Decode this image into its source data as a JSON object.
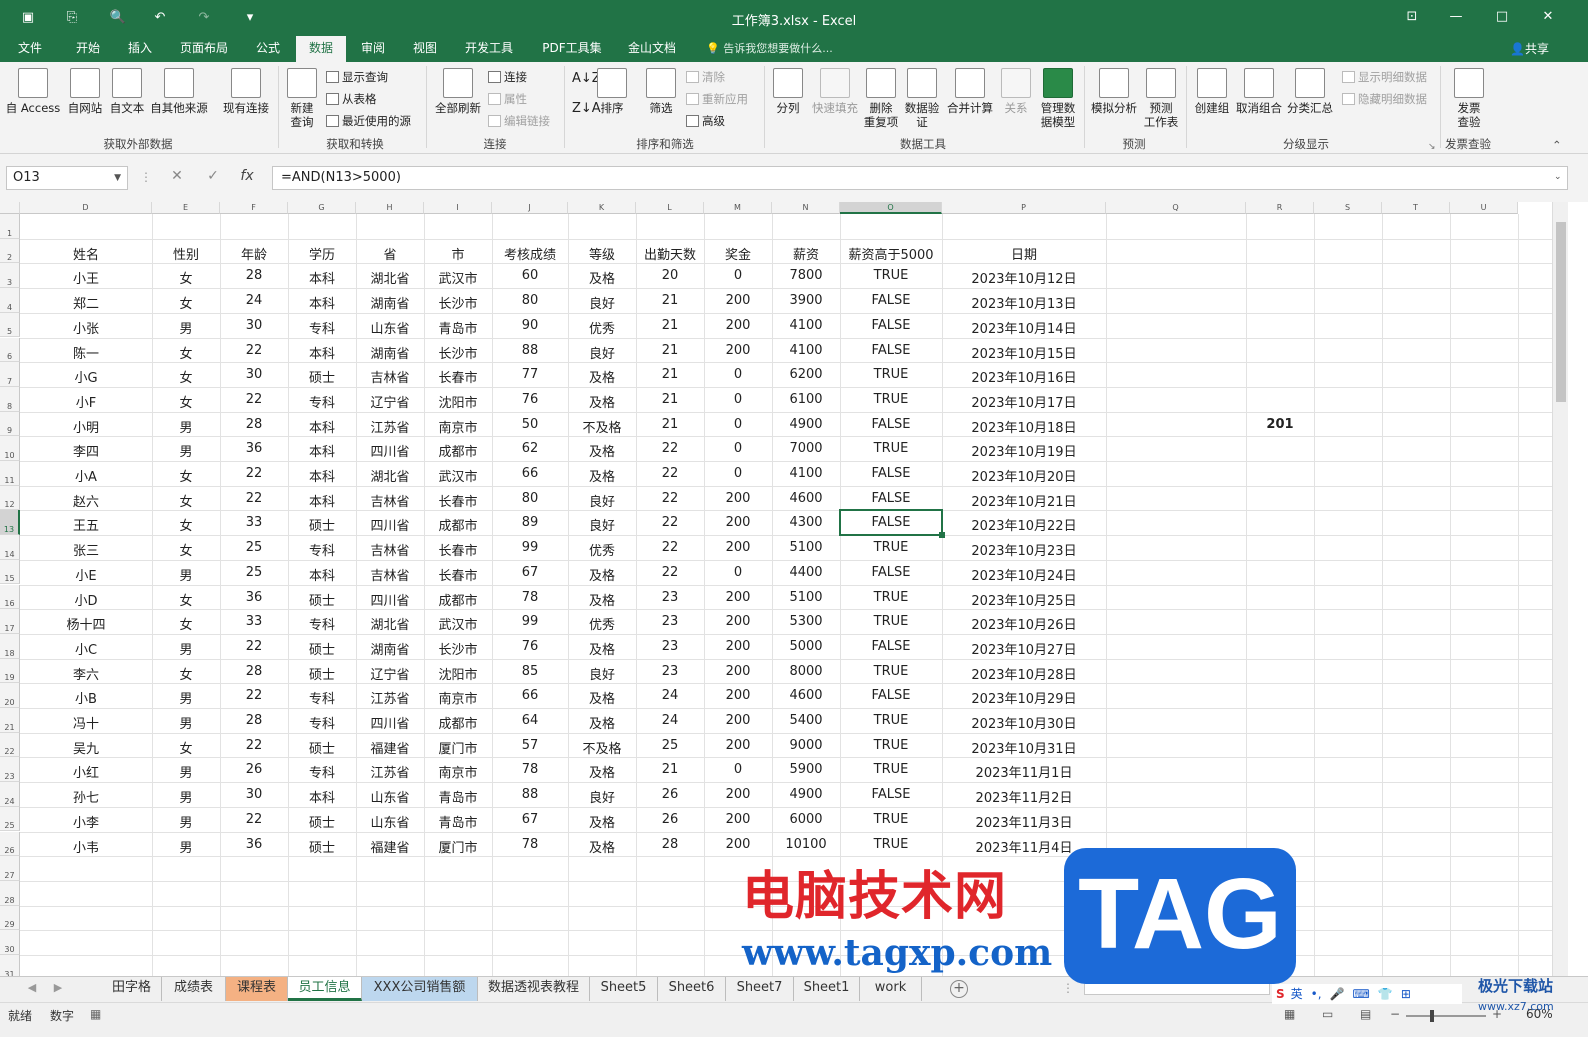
{
  "title": "工作簿3.xlsx - Excel",
  "menu": {
    "tabs": [
      "文件",
      "开始",
      "插入",
      "页面布局",
      "公式",
      "数据",
      "审阅",
      "视图",
      "开发工具",
      "PDF工具集",
      "金山文档"
    ],
    "active": "数据",
    "tell_me": "告诉我您想要做什么...",
    "share": "共享"
  },
  "ribbon": {
    "ext": {
      "access": "自 Access",
      "web": "自网站",
      "text": "自文本",
      "other": "自其他来源",
      "existing": "现有连接",
      "label": "获取外部数据"
    },
    "transform": {
      "new_query": "新建\n查询",
      "show_queries": "显示查询",
      "from_table": "从表格",
      "recent": "最近使用的源",
      "label": "获取和转换"
    },
    "conn": {
      "refresh_all": "全部刷新",
      "connections": "连接",
      "properties": "属性",
      "edit_links": "编辑链接",
      "label": "连接"
    },
    "sort": {
      "sort": "排序",
      "filter": "筛选",
      "clear": "清除",
      "reapply": "重新应用",
      "advanced": "高级",
      "label": "排序和筛选"
    },
    "tools": {
      "split": "分列",
      "flash": "快速填充",
      "dedupe": "删除\n重复项",
      "validate": "数据验\n证",
      "consolidate": "合并计算",
      "relations": "关系",
      "model": "管理数\n据模型",
      "label": "数据工具"
    },
    "forecast": {
      "whatif": "模拟分析",
      "sheet": "预测\n工作表",
      "label": "预测"
    },
    "outline": {
      "group": "创建组",
      "ungroup": "取消组合",
      "subtotal": "分类汇总",
      "show": "显示明细数据",
      "hide": "隐藏明细数据",
      "label": "分级显示"
    },
    "invoice": {
      "check": "发票\n查验",
      "label": "发票查验"
    }
  },
  "formula_bar": {
    "name_box": "O13",
    "formula": "=AND(N13>5000)"
  },
  "col_letters": [
    "D",
    "E",
    "F",
    "G",
    "H",
    "I",
    "J",
    "K",
    "L",
    "M",
    "N",
    "O",
    "P",
    "Q",
    "R",
    "S",
    "T",
    "U"
  ],
  "row_numbers": [
    "1",
    "2",
    "3",
    "4",
    "5",
    "6",
    "7",
    "8",
    "9",
    "10",
    "11",
    "12",
    "13",
    "14",
    "15",
    "16",
    "17",
    "18",
    "19",
    "20",
    "21",
    "22",
    "23",
    "24",
    "25",
    "26",
    "27",
    "28",
    "29",
    "30",
    "31"
  ],
  "headers": [
    "姓名",
    "性别",
    "年龄",
    "学历",
    "省",
    "市",
    "考核成绩",
    "等级",
    "出勤天数",
    "奖金",
    "薪资",
    "薪资高于5000",
    "日期"
  ],
  "rows": [
    [
      "小王",
      "女",
      "28",
      "本科",
      "湖北省",
      "武汉市",
      "60",
      "及格",
      "20",
      "0",
      "7800",
      "TRUE",
      "2023年10月12日"
    ],
    [
      "郑二",
      "女",
      "24",
      "本科",
      "湖南省",
      "长沙市",
      "80",
      "良好",
      "21",
      "200",
      "3900",
      "FALSE",
      "2023年10月13日"
    ],
    [
      "小张",
      "男",
      "30",
      "专科",
      "山东省",
      "青岛市",
      "90",
      "优秀",
      "21",
      "200",
      "4100",
      "FALSE",
      "2023年10月14日"
    ],
    [
      "陈一",
      "女",
      "22",
      "本科",
      "湖南省",
      "长沙市",
      "88",
      "良好",
      "21",
      "200",
      "4100",
      "FALSE",
      "2023年10月15日"
    ],
    [
      "小G",
      "女",
      "30",
      "硕士",
      "吉林省",
      "长春市",
      "77",
      "及格",
      "21",
      "0",
      "6200",
      "TRUE",
      "2023年10月16日"
    ],
    [
      "小F",
      "女",
      "22",
      "专科",
      "辽宁省",
      "沈阳市",
      "76",
      "及格",
      "21",
      "0",
      "6100",
      "TRUE",
      "2023年10月17日"
    ],
    [
      "小明",
      "男",
      "28",
      "本科",
      "江苏省",
      "南京市",
      "50",
      "不及格",
      "21",
      "0",
      "4900",
      "FALSE",
      "2023年10月18日"
    ],
    [
      "李四",
      "男",
      "36",
      "本科",
      "四川省",
      "成都市",
      "62",
      "及格",
      "22",
      "0",
      "7000",
      "TRUE",
      "2023年10月19日"
    ],
    [
      "小A",
      "女",
      "22",
      "本科",
      "湖北省",
      "武汉市",
      "66",
      "及格",
      "22",
      "0",
      "4100",
      "FALSE",
      "2023年10月20日"
    ],
    [
      "赵六",
      "女",
      "22",
      "本科",
      "吉林省",
      "长春市",
      "80",
      "良好",
      "22",
      "200",
      "4600",
      "FALSE",
      "2023年10月21日"
    ],
    [
      "王五",
      "女",
      "33",
      "硕士",
      "四川省",
      "成都市",
      "89",
      "良好",
      "22",
      "200",
      "4300",
      "FALSE",
      "2023年10月22日"
    ],
    [
      "张三",
      "女",
      "25",
      "专科",
      "吉林省",
      "长春市",
      "99",
      "优秀",
      "22",
      "200",
      "5100",
      "TRUE",
      "2023年10月23日"
    ],
    [
      "小E",
      "男",
      "25",
      "本科",
      "吉林省",
      "长春市",
      "67",
      "及格",
      "22",
      "0",
      "4400",
      "FALSE",
      "2023年10月24日"
    ],
    [
      "小D",
      "女",
      "36",
      "硕士",
      "四川省",
      "成都市",
      "78",
      "及格",
      "23",
      "200",
      "5100",
      "TRUE",
      "2023年10月25日"
    ],
    [
      "杨十四",
      "女",
      "33",
      "专科",
      "湖北省",
      "武汉市",
      "99",
      "优秀",
      "23",
      "200",
      "5300",
      "TRUE",
      "2023年10月26日"
    ],
    [
      "小C",
      "男",
      "22",
      "硕士",
      "湖南省",
      "长沙市",
      "76",
      "及格",
      "23",
      "200",
      "5000",
      "FALSE",
      "2023年10月27日"
    ],
    [
      "李六",
      "女",
      "28",
      "硕士",
      "辽宁省",
      "沈阳市",
      "85",
      "良好",
      "23",
      "200",
      "8000",
      "TRUE",
      "2023年10月28日"
    ],
    [
      "小B",
      "男",
      "22",
      "专科",
      "江苏省",
      "南京市",
      "66",
      "及格",
      "24",
      "200",
      "4600",
      "FALSE",
      "2023年10月29日"
    ],
    [
      "冯十",
      "男",
      "28",
      "专科",
      "四川省",
      "成都市",
      "64",
      "及格",
      "24",
      "200",
      "5400",
      "TRUE",
      "2023年10月30日"
    ],
    [
      "吴九",
      "女",
      "22",
      "硕士",
      "福建省",
      "厦门市",
      "57",
      "不及格",
      "25",
      "200",
      "9000",
      "TRUE",
      "2023年10月31日"
    ],
    [
      "小红",
      "男",
      "26",
      "专科",
      "江苏省",
      "南京市",
      "78",
      "及格",
      "21",
      "0",
      "5900",
      "TRUE",
      "2023年11月1日"
    ],
    [
      "孙七",
      "男",
      "30",
      "本科",
      "山东省",
      "青岛市",
      "88",
      "良好",
      "26",
      "200",
      "4900",
      "FALSE",
      "2023年11月2日"
    ],
    [
      "小李",
      "男",
      "22",
      "硕士",
      "山东省",
      "青岛市",
      "67",
      "及格",
      "26",
      "200",
      "6000",
      "TRUE",
      "2023年11月3日"
    ],
    [
      "小韦",
      "男",
      "36",
      "硕士",
      "福建省",
      "厦门市",
      "78",
      "及格",
      "28",
      "200",
      "10100",
      "TRUE",
      "2023年11月4日"
    ]
  ],
  "extra_cell": "201",
  "sheets": [
    "田字格",
    "成绩表",
    "课程表",
    "员工信息",
    "XXX公司销售额",
    "数据透视表教程",
    "Sheet5",
    "Sheet6",
    "Sheet7",
    "Sheet1",
    "work"
  ],
  "active_sheet": "员工信息",
  "status": {
    "ready": "就绪",
    "mode": "数字",
    "zoom": "60%"
  },
  "watermark": {
    "text": "电脑技术网",
    "url": "www.tagxp.com",
    "tag": "TAG",
    "corner_site": "极光下载站",
    "corner_url": "www.xz7.com"
  },
  "ime": {
    "label": "英"
  },
  "colors": {
    "accent": "#217346",
    "watermark_red": "#e0262b",
    "watermark_blue": "#1c6ad8"
  }
}
